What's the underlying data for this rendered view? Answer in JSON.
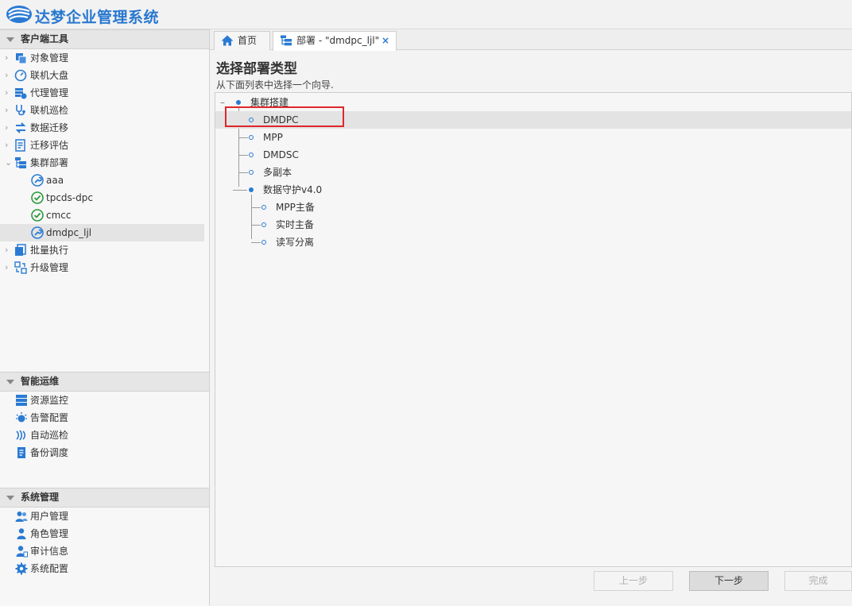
{
  "app": {
    "title": "达梦企业管理系统"
  },
  "sidebar": {
    "sections": [
      {
        "title": "客户端工具",
        "items": [
          {
            "label": "对象管理",
            "icon": "object-icon"
          },
          {
            "label": "联机大盘",
            "icon": "dashboard-icon"
          },
          {
            "label": "代理管理",
            "icon": "agent-icon"
          },
          {
            "label": "联机巡检",
            "icon": "inspect-icon"
          },
          {
            "label": "数据迁移",
            "icon": "migrate-icon"
          },
          {
            "label": "迁移评估",
            "icon": "assess-icon"
          },
          {
            "label": "集群部署",
            "icon": "cluster-icon"
          }
        ],
        "children": [
          {
            "label": "aaa",
            "icon": "wrench-icon"
          },
          {
            "label": "tpcds-dpc",
            "icon": "check-icon"
          },
          {
            "label": "cmcc",
            "icon": "check-icon"
          },
          {
            "label": "dmdpc_ljl",
            "icon": "wrench-icon"
          }
        ],
        "after": [
          {
            "label": "批量执行",
            "icon": "batch-icon"
          },
          {
            "label": "升级管理",
            "icon": "upgrade-icon"
          }
        ]
      },
      {
        "title": "智能运维",
        "items": [
          {
            "label": "资源监控",
            "icon": "monitor-icon"
          },
          {
            "label": "告警配置",
            "icon": "alarm-icon"
          },
          {
            "label": "自动巡检",
            "icon": "auto-inspect-icon"
          },
          {
            "label": "备份调度",
            "icon": "backup-icon"
          }
        ]
      },
      {
        "title": "系统管理",
        "items": [
          {
            "label": "用户管理",
            "icon": "users-icon"
          },
          {
            "label": "角色管理",
            "icon": "role-icon"
          },
          {
            "label": "审计信息",
            "icon": "audit-icon"
          },
          {
            "label": "系统配置",
            "icon": "gear-icon"
          }
        ]
      }
    ]
  },
  "tabs": [
    {
      "label": "首页",
      "icon": "home-icon"
    },
    {
      "label": "部署 - \"dmdpc_ljl\"",
      "icon": "deploy-icon",
      "close": "×"
    }
  ],
  "main": {
    "title": "选择部署类型",
    "subtitle": "从下面列表中选择一个向导.",
    "tree": {
      "collapse": "–",
      "root1": "集群搭建",
      "root1_children": [
        "DMDPC",
        "MPP",
        "DMDSC",
        "多副本"
      ],
      "root2": "数据守护v4.0",
      "root2_children": [
        "MPP主备",
        "实时主备",
        "读写分离"
      ]
    },
    "buttons": {
      "prev": "上一步",
      "next": "下一步",
      "finish": "完成"
    }
  },
  "colors": {
    "accent": "#2a7ad4",
    "highlight_box": "#e0262a",
    "title": "#2878d0"
  }
}
